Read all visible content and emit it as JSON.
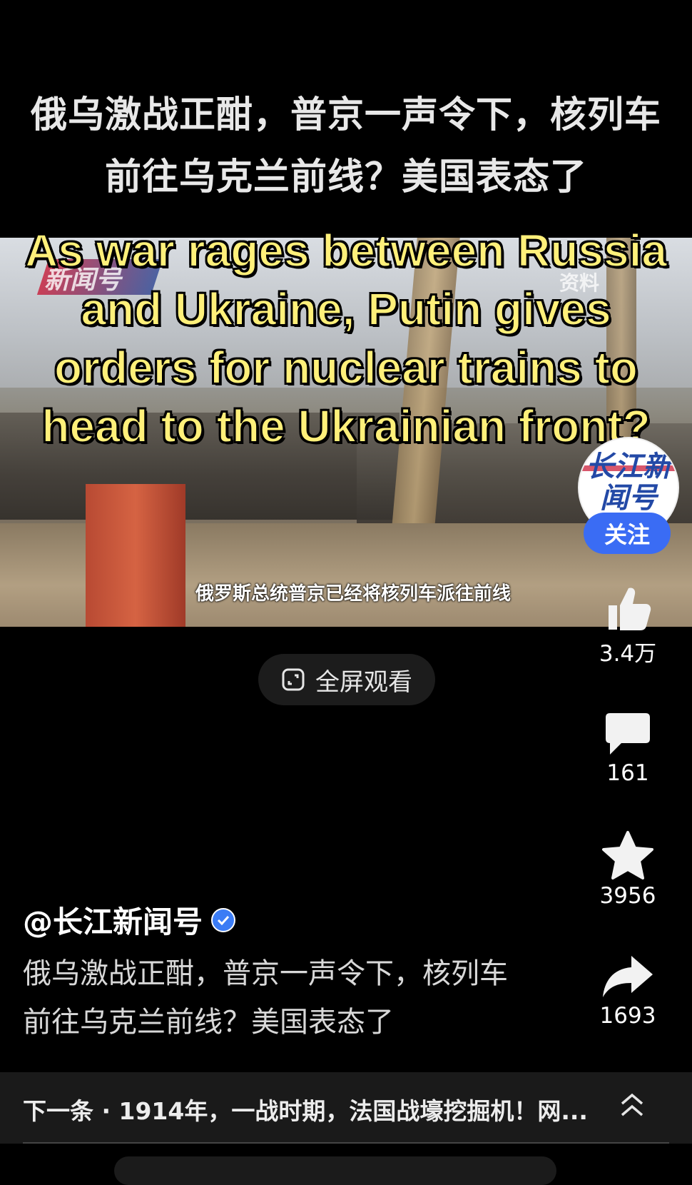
{
  "video": {
    "title": "俄乌激战正酣，普京一声令下，核列车前往乌克兰前线？美国表态了",
    "english_overlay": "As war rages between Russia and Ukraine, Putin gives orders for nuclear trains to head to the Ukrainian front?",
    "caption": "俄罗斯总统普京已经将核列车派往前线",
    "news_logo": "新闻号",
    "source_tag": "资料"
  },
  "author": {
    "avatar_text": "长江新闻号",
    "follow_label": "关注",
    "handle": "@长江新闻号",
    "description": "俄乌激战正酣，普京一声令下，核列车前往乌克兰前线？美国表态了"
  },
  "actions": {
    "likes": "3.4万",
    "comments": "161",
    "favorites": "3956",
    "shares": "1693"
  },
  "fullscreen": {
    "label": "全屏观看"
  },
  "next_up": {
    "label": "下一条 · 1914年，一战时期，法国战壕挖掘机！网..."
  },
  "icons": [
    "like-icon",
    "comment-icon",
    "star-icon",
    "share-icon",
    "fullscreen-icon",
    "verified-icon",
    "chevron-up-icon"
  ],
  "colors": {
    "accent": "#3a6cf4",
    "overlay_text": "#fff07a"
  }
}
